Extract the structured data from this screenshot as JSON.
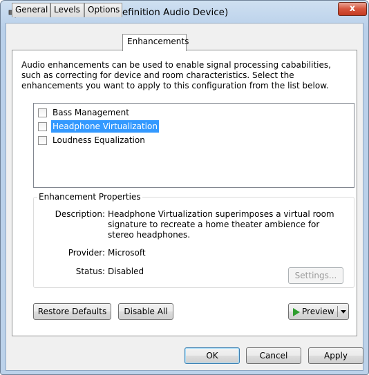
{
  "window": {
    "title": "Headphones (High Definition Audio Device)",
    "close_label": "x"
  },
  "tabs": [
    {
      "label": "General",
      "active": false
    },
    {
      "label": "Levels",
      "active": false
    },
    {
      "label": "Options",
      "active": false
    },
    {
      "label": "Enhancements",
      "active": true
    }
  ],
  "enhancements": {
    "intro": "Audio enhancements can be used to enable signal processing cababilities, such as correcting for device and room characteristics. Select the enhancements you want to apply to this configuration from the list below.",
    "items": [
      {
        "label": "Bass Management",
        "checked": false,
        "selected": false
      },
      {
        "label": "Headphone Virtualization",
        "checked": false,
        "selected": true
      },
      {
        "label": "Loudness Equalization",
        "checked": false,
        "selected": false
      }
    ]
  },
  "properties": {
    "legend": "Enhancement Properties",
    "description_label": "Description:",
    "description_value": "Headphone Virtualization superimposes a virtual room signature to recreate a home theater ambience for stereo headphones.",
    "provider_label": "Provider:",
    "provider_value": "Microsoft",
    "status_label": "Status:",
    "status_value": "Disabled",
    "settings_label": "Settings..."
  },
  "actions": {
    "restore_defaults": "Restore Defaults",
    "disable_all": "Disable All",
    "preview": "Preview"
  },
  "footer": {
    "ok": "OK",
    "cancel": "Cancel",
    "apply": "Apply"
  },
  "colors": {
    "selection": "#3399ff",
    "preview_arrow": "#2f9e2f",
    "close_button": "#d6553c"
  }
}
